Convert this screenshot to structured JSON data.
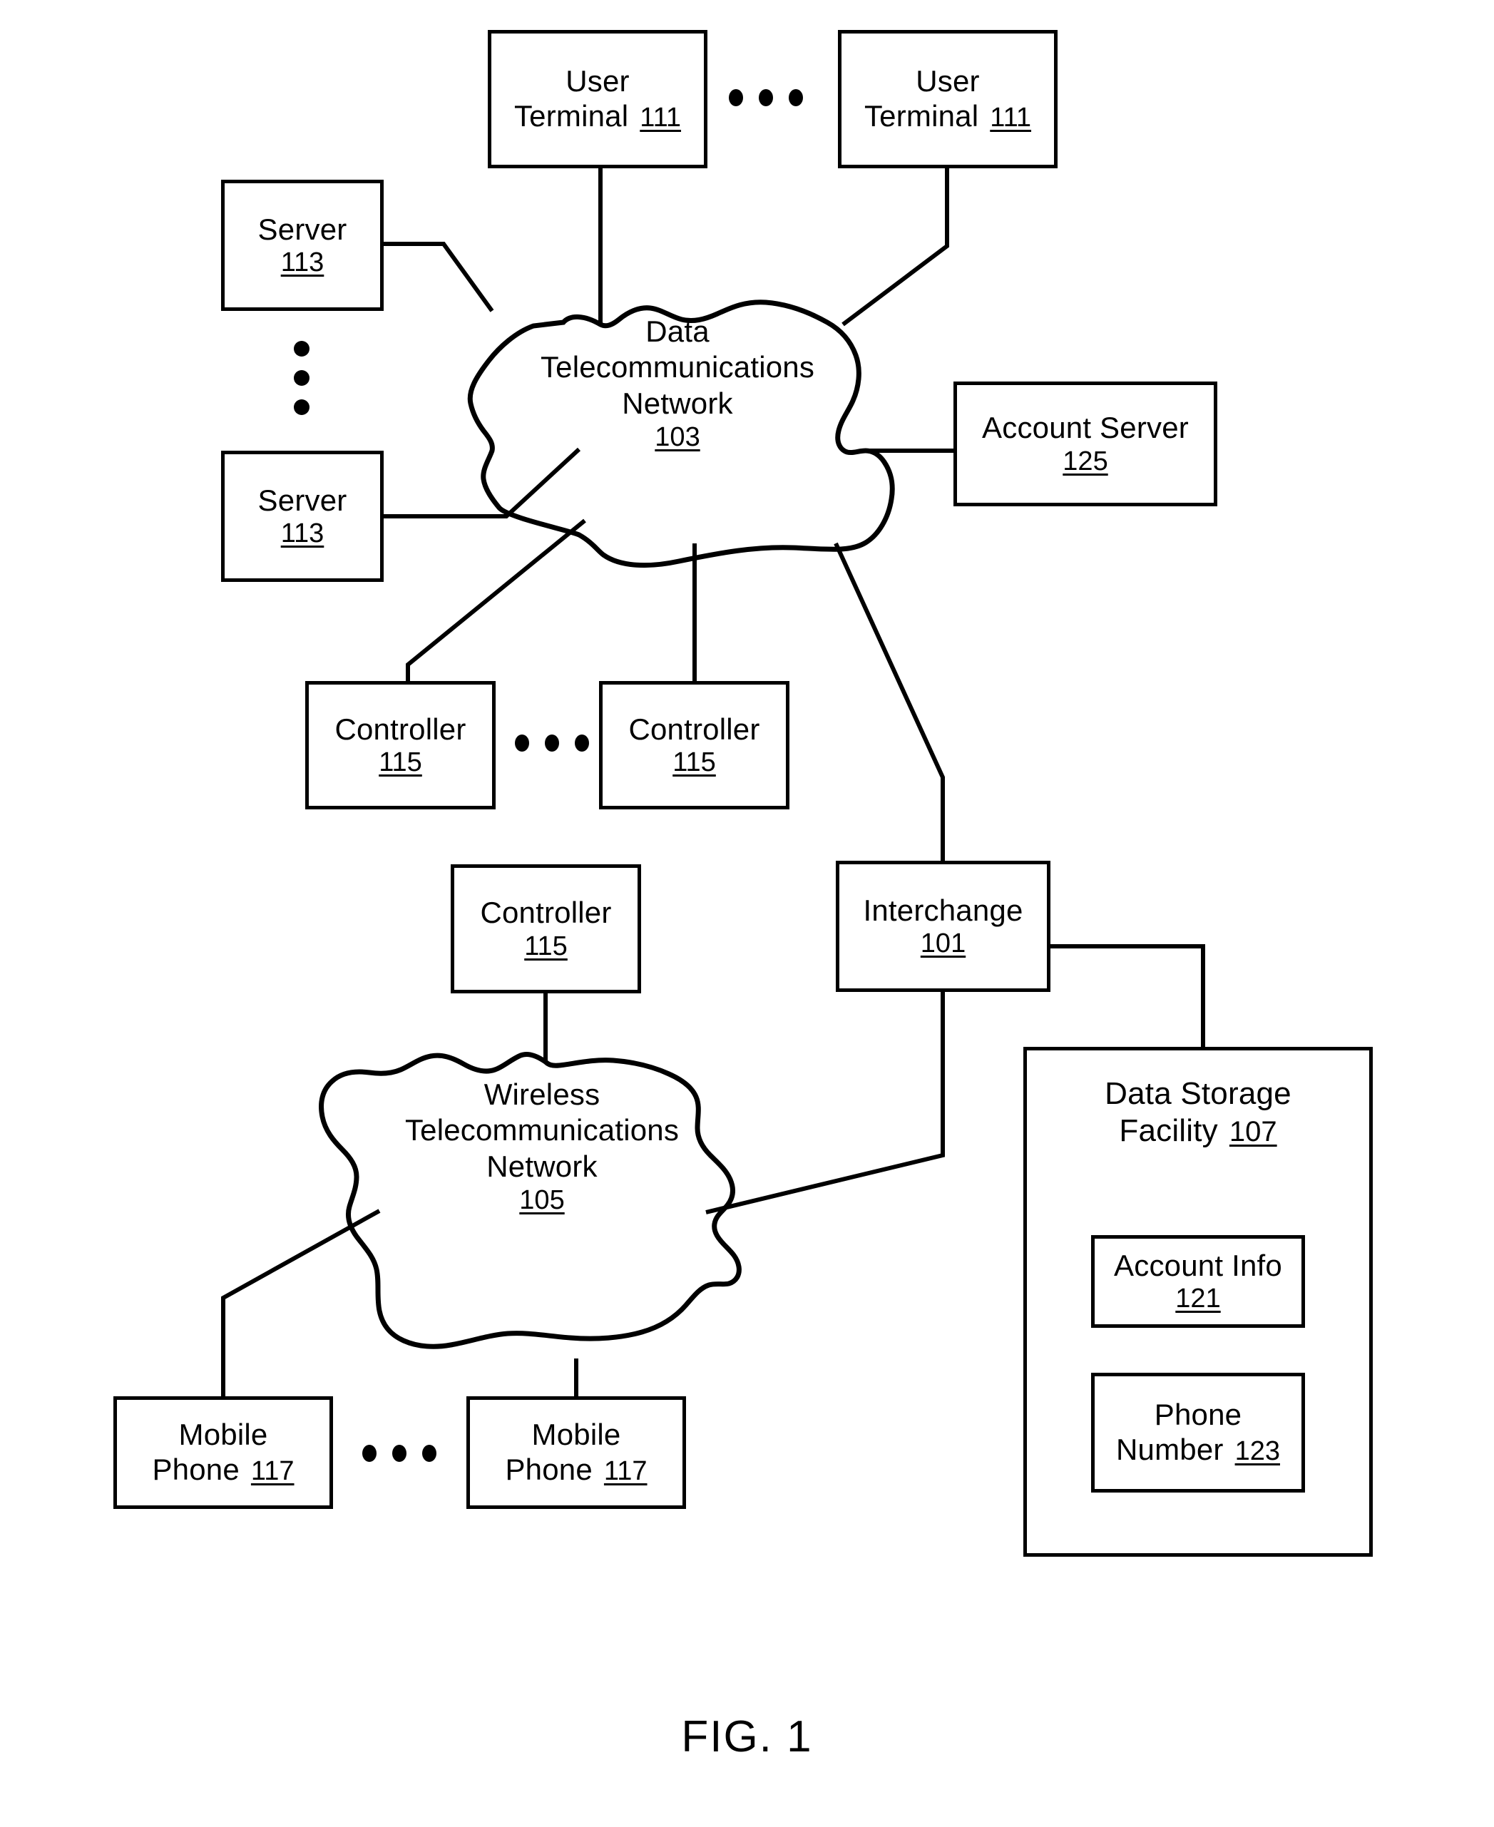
{
  "figure": {
    "caption": "FIG. 1"
  },
  "nodes": {
    "user_terminal_left": {
      "label": "User Terminal",
      "line1": "User",
      "line2": "Terminal",
      "ref": "111"
    },
    "user_terminal_right": {
      "label": "User Terminal",
      "line1": "User",
      "line2": "Terminal",
      "ref": "111"
    },
    "server_top": {
      "line1": "Server",
      "ref": "113"
    },
    "server_bottom": {
      "line1": "Server",
      "ref": "113"
    },
    "account_server": {
      "line1": "Account Server",
      "ref": "125"
    },
    "controller_left": {
      "line1": "Controller",
      "ref": "115"
    },
    "controller_right": {
      "line1": "Controller",
      "ref": "115"
    },
    "controller_wireless": {
      "line1": "Controller",
      "ref": "115"
    },
    "interchange": {
      "line1": "Interchange",
      "ref": "101"
    },
    "mobile_phone_left": {
      "line1": "Mobile",
      "line2": "Phone",
      "ref": "117"
    },
    "mobile_phone_right": {
      "line1": "Mobile",
      "line2": "Phone",
      "ref": "117"
    },
    "data_storage_facility": {
      "line1": "Data Storage",
      "line2": "Facility",
      "ref": "107"
    },
    "account_info": {
      "line1": "Account Info",
      "ref": "121"
    },
    "phone_number": {
      "line1": "Phone",
      "line2": "Number",
      "ref": "123"
    }
  },
  "clouds": {
    "data_network": {
      "line1": "Data",
      "line2": "Telecommunications",
      "line3": "Network",
      "ref": "103"
    },
    "wireless_network": {
      "line1": "Wireless",
      "line2": "Telecommunications",
      "line3": "Network",
      "ref": "105"
    }
  },
  "ellipses": {
    "between_user_terminals": "horizontal-ellipsis",
    "between_servers": "vertical-ellipsis",
    "between_controllers": "horizontal-ellipsis",
    "between_mobile_phones": "horizontal-ellipsis"
  },
  "style": {
    "stroke": "#000000",
    "background": "#ffffff"
  }
}
